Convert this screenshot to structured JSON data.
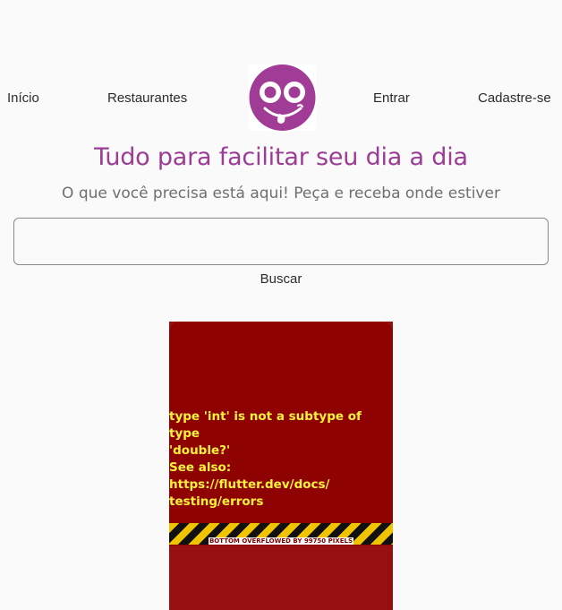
{
  "nav": {
    "inicio": "Início",
    "restaurantes": "Restaurantes",
    "entrar": "Entrar",
    "cadastre": "Cadastre-se"
  },
  "logo": {
    "icon": "smiley-face-logo",
    "color": "#a13c96"
  },
  "hero": {
    "title": "Tudo para facilitar seu dia a dia",
    "subtitle": "O que você precisa está aqui! Peça e receba onde estiver"
  },
  "search": {
    "value": "",
    "placeholder": "",
    "button_label": "Buscar"
  },
  "error": {
    "line1": "type 'int' is not a subtype of type",
    "line2": "'double?'",
    "line3": "See also: https://flutter.dev/docs/",
    "line4": "testing/errors",
    "overflow_label": "BOTTOM OVERFLOWED BY 99750 PIXELS",
    "background": "#8f0202",
    "text_color": "#fff23a"
  }
}
